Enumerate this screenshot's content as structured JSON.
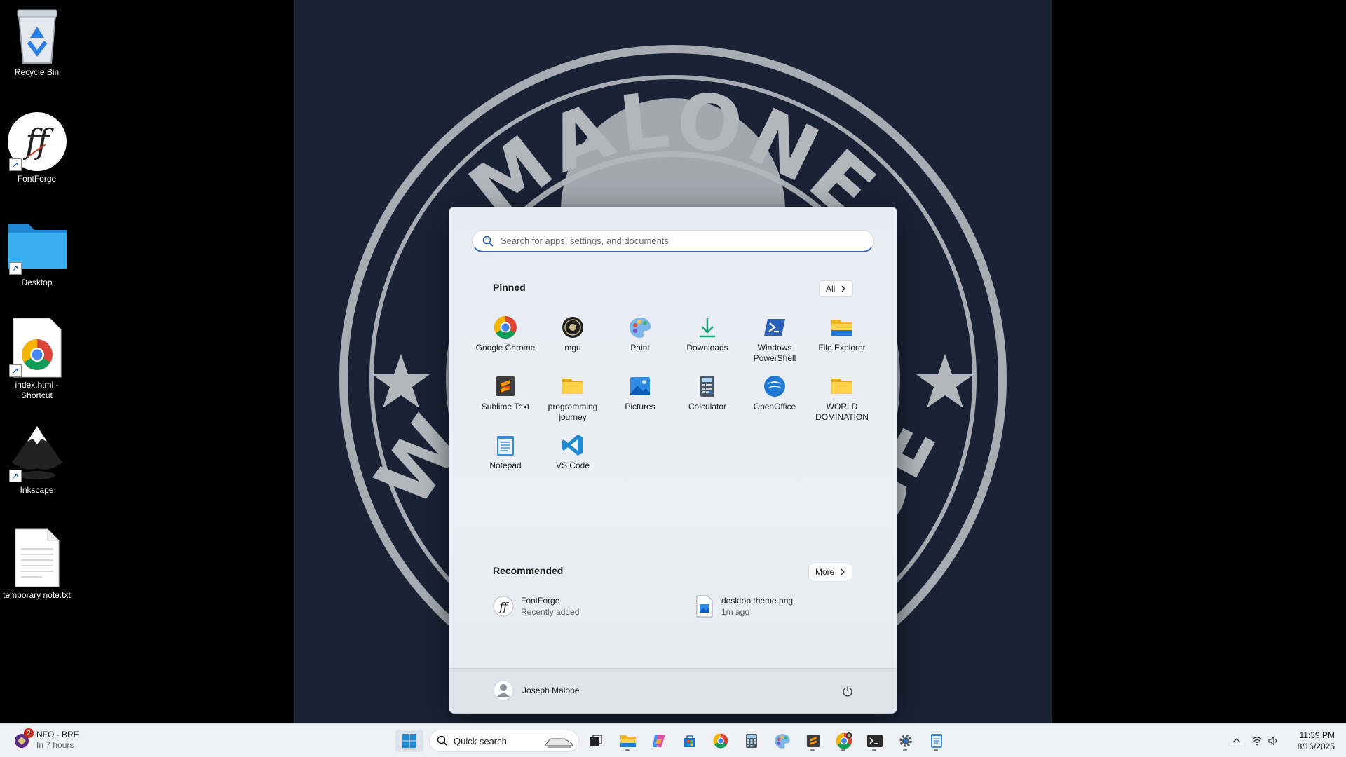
{
  "wallpaper": {
    "top_text": "MALONE",
    "bottom_text_left": "W",
    "bottom_text_right": "GE"
  },
  "desktop": {
    "icons": [
      {
        "label": "Recycle Bin",
        "icon": "recycle-bin-icon"
      },
      {
        "label": "FontForge",
        "icon": "fontforge-icon"
      },
      {
        "label": "Desktop",
        "icon": "folder-icon"
      },
      {
        "label": "index.html - Shortcut",
        "icon": "chrome-document-icon"
      },
      {
        "label": "Inkscape",
        "icon": "inkscape-icon"
      },
      {
        "label": "temporary note.txt",
        "icon": "text-file-icon"
      }
    ]
  },
  "start_menu": {
    "search_placeholder": "Search for apps, settings, and documents",
    "pinned_label": "Pinned",
    "all_label": "All",
    "pinned": [
      {
        "label": "Google Chrome",
        "icon": "chrome-icon"
      },
      {
        "label": "mgu",
        "icon": "mgu-icon"
      },
      {
        "label": "Paint",
        "icon": "paint-icon"
      },
      {
        "label": "Downloads",
        "icon": "downloads-icon"
      },
      {
        "label": "Windows PowerShell",
        "icon": "powershell-icon"
      },
      {
        "label": "File Explorer",
        "icon": "file-explorer-icon"
      },
      {
        "label": "Sublime Text",
        "icon": "sublime-text-icon"
      },
      {
        "label": "programming journey",
        "icon": "folder-icon"
      },
      {
        "label": "Pictures",
        "icon": "pictures-icon"
      },
      {
        "label": "Calculator",
        "icon": "calculator-icon"
      },
      {
        "label": "OpenOffice",
        "icon": "openoffice-icon"
      },
      {
        "label": "WORLD DOMINATION",
        "icon": "folder-icon"
      },
      {
        "label": "Notepad",
        "icon": "notepad-icon"
      },
      {
        "label": "VS Code",
        "icon": "vscode-icon"
      }
    ],
    "recommended_label": "Recommended",
    "more_label": "More",
    "recommended": [
      {
        "title": "FontForge",
        "subtitle": "Recently added",
        "icon": "fontforge-icon"
      },
      {
        "title": "desktop theme.png",
        "subtitle": "1m ago",
        "icon": "image-file-icon"
      }
    ],
    "user_name": "Joseph Malone"
  },
  "taskbar": {
    "weather_title": "NFO - BRE",
    "weather_subtitle": "In 7 hours",
    "weather_badge": "2",
    "search_label": "Quick search",
    "time": "11:39 PM",
    "date": "8/16/2025"
  },
  "colors": {
    "accent": "#2a62c9",
    "wallpaper_bg": "#1a2336",
    "wallpaper_emblem": "#9aa0a6",
    "badge": "#c42b1c"
  }
}
